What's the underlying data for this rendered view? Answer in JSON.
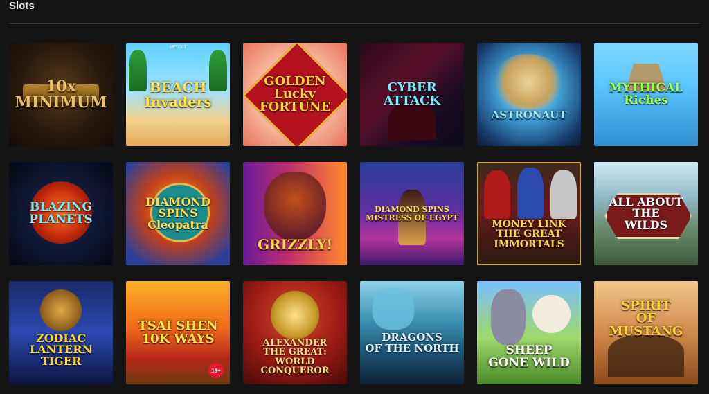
{
  "section": {
    "title": "Slots"
  },
  "games": [
    {
      "id": "g1",
      "title": "10x\nMINIMUM",
      "color": "#e8c06a",
      "size": "22px"
    },
    {
      "id": "g2",
      "title": "BEACH\nInvaders",
      "brand": "NETENT",
      "color": "#ffe14d",
      "size": "20px"
    },
    {
      "id": "g3",
      "title": "GOLDEN\nLucky\nFORTUNE",
      "color": "#ffd23a",
      "size": "18px"
    },
    {
      "id": "g4",
      "title": "CYBER\nATTACK",
      "color": "#6ff0ff",
      "size": "18px"
    },
    {
      "id": "g5",
      "title": "ASTRONAUT",
      "color": "#9be8ff",
      "size": "15px"
    },
    {
      "id": "g6",
      "title": "MYTHICAL\nRiches",
      "color": "#9dff5c",
      "size": "17px"
    },
    {
      "id": "g7",
      "title": "BLAZING\nPLANETS",
      "color": "#7fe9ff",
      "size": "17px"
    },
    {
      "id": "g8",
      "title": "DIAMOND SPINS\nCleopatra",
      "color": "#ffdc5a",
      "size": "16px"
    },
    {
      "id": "g9",
      "title": "GRIZZLY!",
      "color": "#ffd84a",
      "size": "20px"
    },
    {
      "id": "g10",
      "title": "DIAMOND SPINS\nMISTRESS OF EGYPT",
      "color": "#ffdc5a",
      "size": "11px"
    },
    {
      "id": "g11",
      "title": "MONEY LINK\nTHE GREAT\nIMMORTALS",
      "color": "#ffd64a",
      "size": "14px"
    },
    {
      "id": "g12",
      "title": "ALL ABOUT THE\nWILDS",
      "color": "#ffffff",
      "size": "16px"
    },
    {
      "id": "g13",
      "title": "ZODIAC\nLANTERN\nTIGER",
      "color": "#ffd23a",
      "size": "16px"
    },
    {
      "id": "g14",
      "title": "TSAI SHEN\n10K WAYS",
      "color": "#ffe14d",
      "size": "18px",
      "badge": "18+"
    },
    {
      "id": "g15",
      "title": "ALEXANDER\nTHE GREAT:\nWORLD CONQUEROR",
      "color": "#ffe08a",
      "size": "13px"
    },
    {
      "id": "g16",
      "title": "DRAGONS\nOF THE NORTH",
      "color": "#dff6ff",
      "size": "15px"
    },
    {
      "id": "g17",
      "title": "SHEEP\nGONE WILD",
      "color": "#ffffff",
      "size": "17px"
    },
    {
      "id": "g18",
      "title": "SPIRIT\nOF\nMUSTANG",
      "color": "#ffcf3a",
      "size": "18px"
    }
  ]
}
